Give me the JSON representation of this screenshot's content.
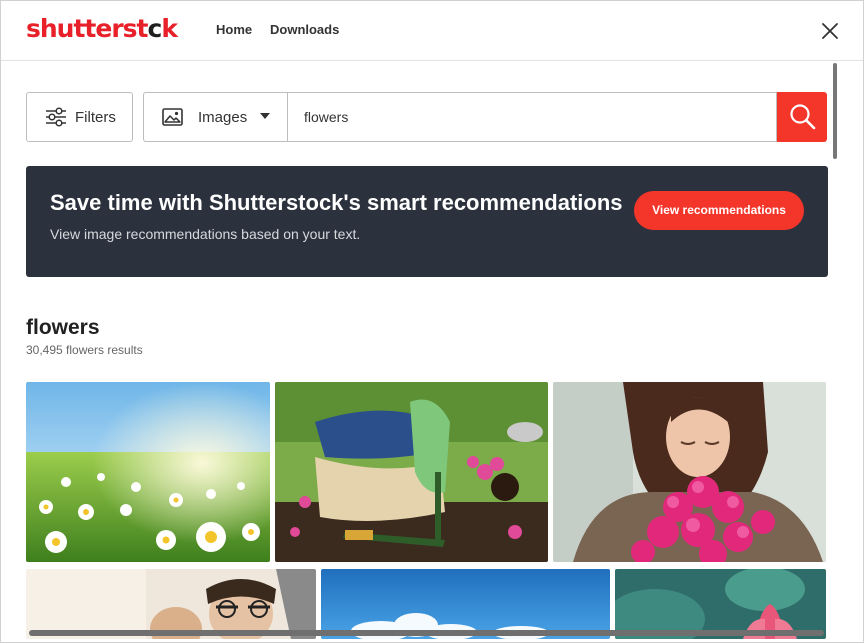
{
  "header": {
    "logo_main": "shutterst",
    "logo_c": "c",
    "logo_tail": "k",
    "nav": [
      "Home",
      "Downloads"
    ]
  },
  "search": {
    "filters_label": "Filters",
    "type_label": "Images",
    "query": "flowers"
  },
  "banner": {
    "title": "Save time with Shutterstock's smart recommendations",
    "subtitle": "View image recommendations based on your text.",
    "cta": "View recommendations"
  },
  "results": {
    "heading": "flowers",
    "count_text": "30,495 flowers results"
  },
  "colors": {
    "brand_red": "#f4352a",
    "banner_bg": "#2b323d"
  },
  "icons": [
    "filters-icon",
    "image-icon",
    "caret-down-icon",
    "search-icon",
    "close-icon"
  ]
}
